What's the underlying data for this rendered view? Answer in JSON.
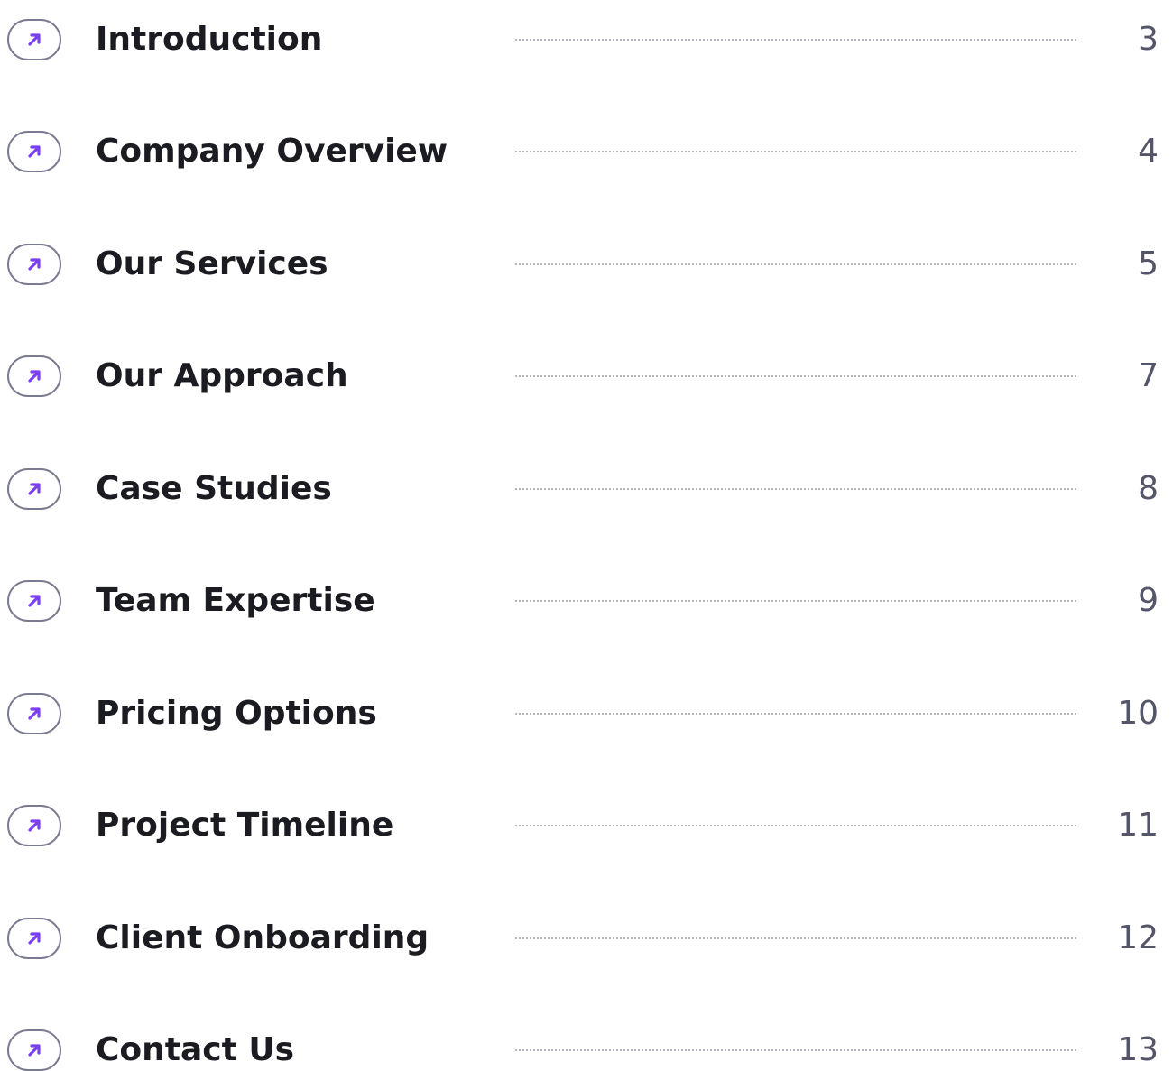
{
  "accent_color": "#7b3ff2",
  "entries": [
    {
      "title": "Introduction",
      "page": "3",
      "icon": "arrow-up-right-icon"
    },
    {
      "title": "Company Overview",
      "page": "4",
      "icon": "arrow-up-right-icon"
    },
    {
      "title": "Our Services",
      "page": "5",
      "icon": "arrow-up-right-icon"
    },
    {
      "title": "Our Approach",
      "page": "7",
      "icon": "arrow-up-right-icon"
    },
    {
      "title": "Case Studies",
      "page": "8",
      "icon": "arrow-up-right-icon"
    },
    {
      "title": "Team Expertise",
      "page": "9",
      "icon": "arrow-up-right-icon"
    },
    {
      "title": "Pricing Options",
      "page": "10",
      "icon": "arrow-up-right-icon"
    },
    {
      "title": "Project Timeline",
      "page": "11",
      "icon": "arrow-up-right-icon"
    },
    {
      "title": "Client Onboarding",
      "page": "12",
      "icon": "arrow-up-right-icon"
    },
    {
      "title": "Contact Us",
      "page": "13",
      "icon": "arrow-up-right-icon"
    }
  ]
}
